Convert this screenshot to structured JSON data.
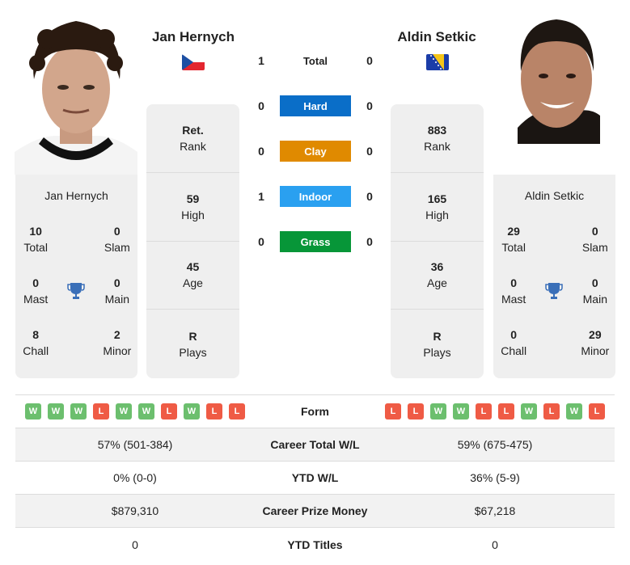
{
  "player1": {
    "name": "Jan Hernych",
    "country_flag": "czech-republic-flag",
    "rank": {
      "value": "Ret.",
      "label": "Rank"
    },
    "high": {
      "value": "59",
      "label": "High"
    },
    "age": {
      "value": "45",
      "label": "Age"
    },
    "plays": {
      "value": "R",
      "label": "Plays"
    },
    "titles": {
      "total": {
        "value": "10",
        "label": "Total"
      },
      "slam": {
        "value": "0",
        "label": "Slam"
      },
      "mast": {
        "value": "0",
        "label": "Mast"
      },
      "main": {
        "value": "0",
        "label": "Main"
      },
      "chall": {
        "value": "8",
        "label": "Chall"
      },
      "minor": {
        "value": "2",
        "label": "Minor"
      }
    },
    "form": [
      "W",
      "W",
      "W",
      "L",
      "W",
      "W",
      "L",
      "W",
      "L",
      "L"
    ]
  },
  "player2": {
    "name": "Aldin Setkic",
    "country_flag": "bosnia-herzegovina-flag",
    "rank": {
      "value": "883",
      "label": "Rank"
    },
    "high": {
      "value": "165",
      "label": "High"
    },
    "age": {
      "value": "36",
      "label": "Age"
    },
    "plays": {
      "value": "R",
      "label": "Plays"
    },
    "titles": {
      "total": {
        "value": "29",
        "label": "Total"
      },
      "slam": {
        "value": "0",
        "label": "Slam"
      },
      "mast": {
        "value": "0",
        "label": "Mast"
      },
      "main": {
        "value": "0",
        "label": "Main"
      },
      "chall": {
        "value": "0",
        "label": "Chall"
      },
      "minor": {
        "value": "29",
        "label": "Minor"
      }
    },
    "form": [
      "L",
      "L",
      "W",
      "W",
      "L",
      "L",
      "W",
      "L",
      "W",
      "L"
    ]
  },
  "h2h": [
    {
      "label": "Total",
      "p1": "1",
      "p2": "0",
      "color": ""
    },
    {
      "label": "Hard",
      "p1": "0",
      "p2": "0",
      "color": "#0a6ec8"
    },
    {
      "label": "Clay",
      "p1": "0",
      "p2": "0",
      "color": "#e08a00"
    },
    {
      "label": "Indoor",
      "p1": "1",
      "p2": "0",
      "color": "#2aa0f0"
    },
    {
      "label": "Grass",
      "p1": "0",
      "p2": "0",
      "color": "#079638"
    }
  ],
  "form_label": "Form",
  "comparison": [
    {
      "label": "Career Total W/L",
      "p1": "57% (501-384)",
      "p2": "59% (675-475)"
    },
    {
      "label": "YTD W/L",
      "p1": "0% (0-0)",
      "p2": "36% (5-9)"
    },
    {
      "label": "Career Prize Money",
      "p1": "$879,310",
      "p2": "$67,218"
    },
    {
      "label": "YTD Titles",
      "p1": "0",
      "p2": "0"
    }
  ],
  "colors": {
    "win": "#6cbf6e",
    "loss": "#ef5b45",
    "trophy": "#3a6fb8",
    "panel": "#efefef"
  }
}
